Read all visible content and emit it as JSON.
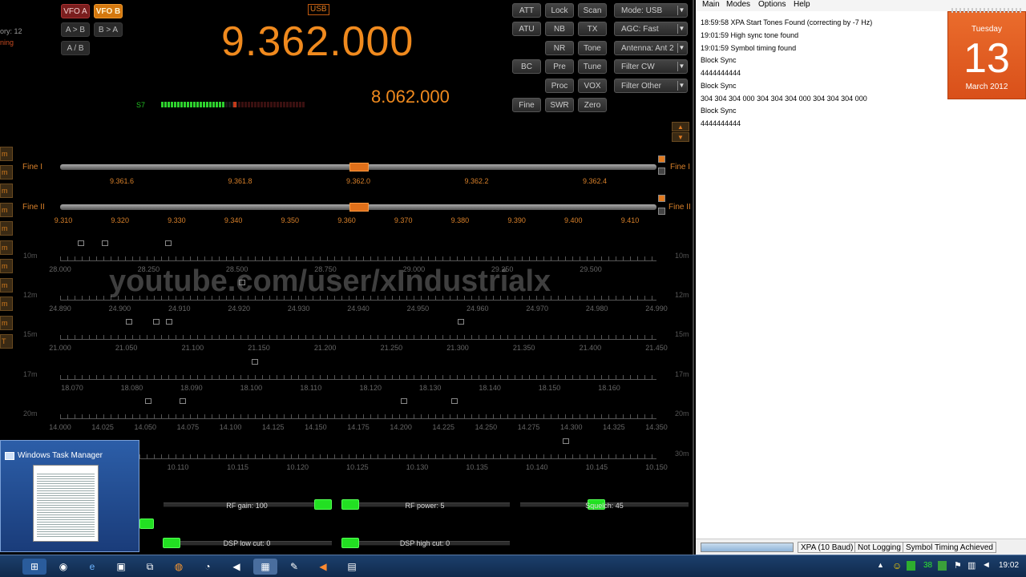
{
  "radio": {
    "mode_tag": "USB",
    "main_freq": "9.362.000",
    "sub_freq": "8.062.000",
    "smeter_label": "S7",
    "left_cut_text": [
      "ory: 12",
      "ning"
    ],
    "vfo_a_label": "VFO A",
    "vfo_b_label": "VFO B",
    "a_to_b_label": "A > B",
    "b_to_a_label": "B > A",
    "a_slash_b_label": "A / B",
    "buttons": {
      "att": "ATT",
      "lock": "Lock",
      "scan": "Scan",
      "atu": "ATU",
      "nb": "NB",
      "tx": "TX",
      "nr": "NR",
      "tone": "Tone",
      "bc": "BC",
      "pre": "Pre",
      "tune": "Tune",
      "proc": "Proc",
      "vox": "VOX",
      "fine": "Fine",
      "swr": "SWR",
      "zero": "Zero"
    },
    "dropdowns": {
      "mode": "Mode: USB",
      "agc": "AGC: Fast",
      "antenna": "Antenna: Ant 2",
      "filter_cw": "Filter CW",
      "filter_other": "Filter Other"
    },
    "left_tabs": [
      "m",
      "m",
      "m",
      "m",
      "m",
      "m",
      "m",
      "m",
      "m",
      "m",
      "T"
    ],
    "fine1": {
      "label": "Fine I",
      "ticks": [
        "9.361.6",
        "9.361.8",
        "9.362.0",
        "9.362.2",
        "9.362.4"
      ]
    },
    "fine2": {
      "label": "Fine II",
      "ticks": [
        "9.310",
        "9.320",
        "9.330",
        "9.340",
        "9.350",
        "9.360",
        "9.370",
        "9.380",
        "9.390",
        "9.400",
        "9.410"
      ]
    },
    "bands": [
      {
        "label": "10m",
        "ticks": [
          "28.000",
          "28.250",
          "28.500",
          "28.750",
          "29.000",
          "29.250",
          "29.500"
        ]
      },
      {
        "label": "12m",
        "ticks": [
          "24.890",
          "24.900",
          "24.910",
          "24.920",
          "24.930",
          "24.940",
          "24.950",
          "24.960",
          "24.970",
          "24.980",
          "24.990"
        ]
      },
      {
        "label": "15m",
        "ticks": [
          "21.000",
          "21.050",
          "21.100",
          "21.150",
          "21.200",
          "21.250",
          "21.300",
          "21.350",
          "21.400",
          "21.450"
        ]
      },
      {
        "label": "17m",
        "ticks": [
          "18.070",
          "18.080",
          "18.090",
          "18.100",
          "18.110",
          "18.120",
          "18.130",
          "18.140",
          "18.150",
          "18.160"
        ]
      },
      {
        "label": "20m",
        "ticks": [
          "14.000",
          "14.025",
          "14.050",
          "14.075",
          "14.100",
          "14.125",
          "14.150",
          "14.175",
          "14.200",
          "14.225",
          "14.250",
          "14.275",
          "14.300",
          "14.325",
          "14.350"
        ]
      },
      {
        "label": "30m",
        "ticks": [
          "10.110",
          "10.115",
          "10.120",
          "10.125",
          "10.130",
          "10.135",
          "10.140",
          "10.145",
          "10.150"
        ]
      }
    ],
    "sliders": {
      "rf_gain": "RF gain: 100",
      "rf_power": "RF power: 5",
      "squelch": "Squelch: 45",
      "dsp_low": "DSP low cut: 0",
      "dsp_high": "DSP high cut: 0"
    },
    "watermark": "youtube.com/user/xIndustrialx"
  },
  "taskmgr": {
    "title": "Windows Task Manager"
  },
  "decoder": {
    "menu": [
      "Main",
      "Modes",
      "Options",
      "Help"
    ],
    "log": [
      "18:59:58 XPA Start Tones Found (correcting by -7 Hz)",
      "19:01:59 High sync tone found",
      "19:01:59 Symbol timing found",
      "Block Sync",
      "4444444444",
      "Block Sync",
      "304 304 304 000 304 304 304 000 304 304 304 000",
      "Block Sync",
      "4444444444"
    ],
    "calendar": {
      "weekday": "Tuesday",
      "day": "13",
      "month_year": "March 2012"
    },
    "status": {
      "mode": "XPA (10 Baud)",
      "logging": "Not Logging",
      "state": "Symbol Timing Achieved"
    }
  },
  "taskbar": {
    "tray_number": "38",
    "clock": "19:02"
  }
}
